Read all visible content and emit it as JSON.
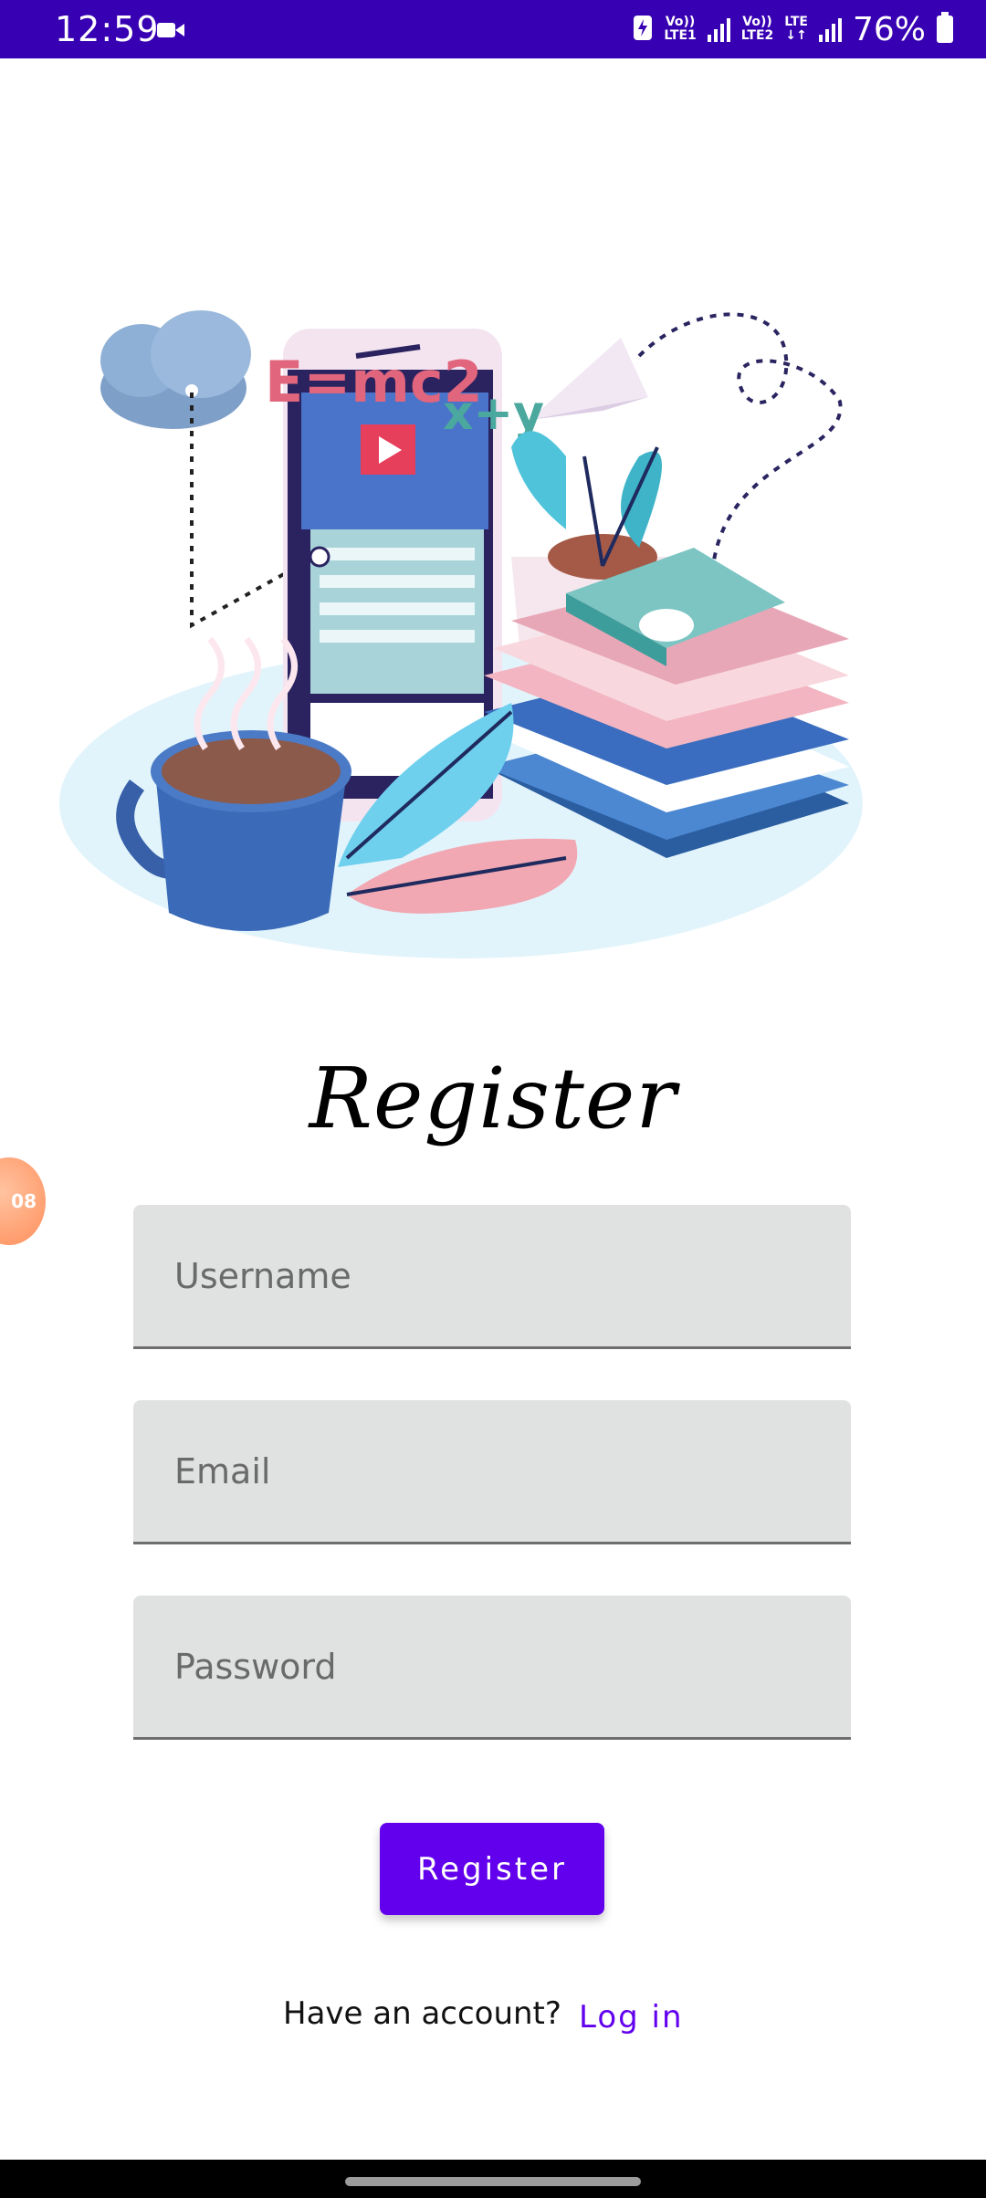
{
  "status_bar": {
    "time": "12:59",
    "network1_top": "Vo))",
    "network1_bottom": "LTE1",
    "network2_top": "Vo))",
    "network2_bottom": "LTE2",
    "network_type": "LTE",
    "battery_percent": "76%"
  },
  "illustration": {
    "formula1": "E=mc2",
    "formula2": "x+y"
  },
  "floating_bubble": {
    "label": "08"
  },
  "form": {
    "title": "Register",
    "username_placeholder": "Username",
    "email_placeholder": "Email",
    "password_placeholder": "Password",
    "register_label": "Register"
  },
  "footer": {
    "question": "Have an account?",
    "login_label": "Log in"
  },
  "colors": {
    "status_bar": "#3700b3",
    "accent": "#6200ee",
    "field_bg": "#e0e1e1"
  }
}
